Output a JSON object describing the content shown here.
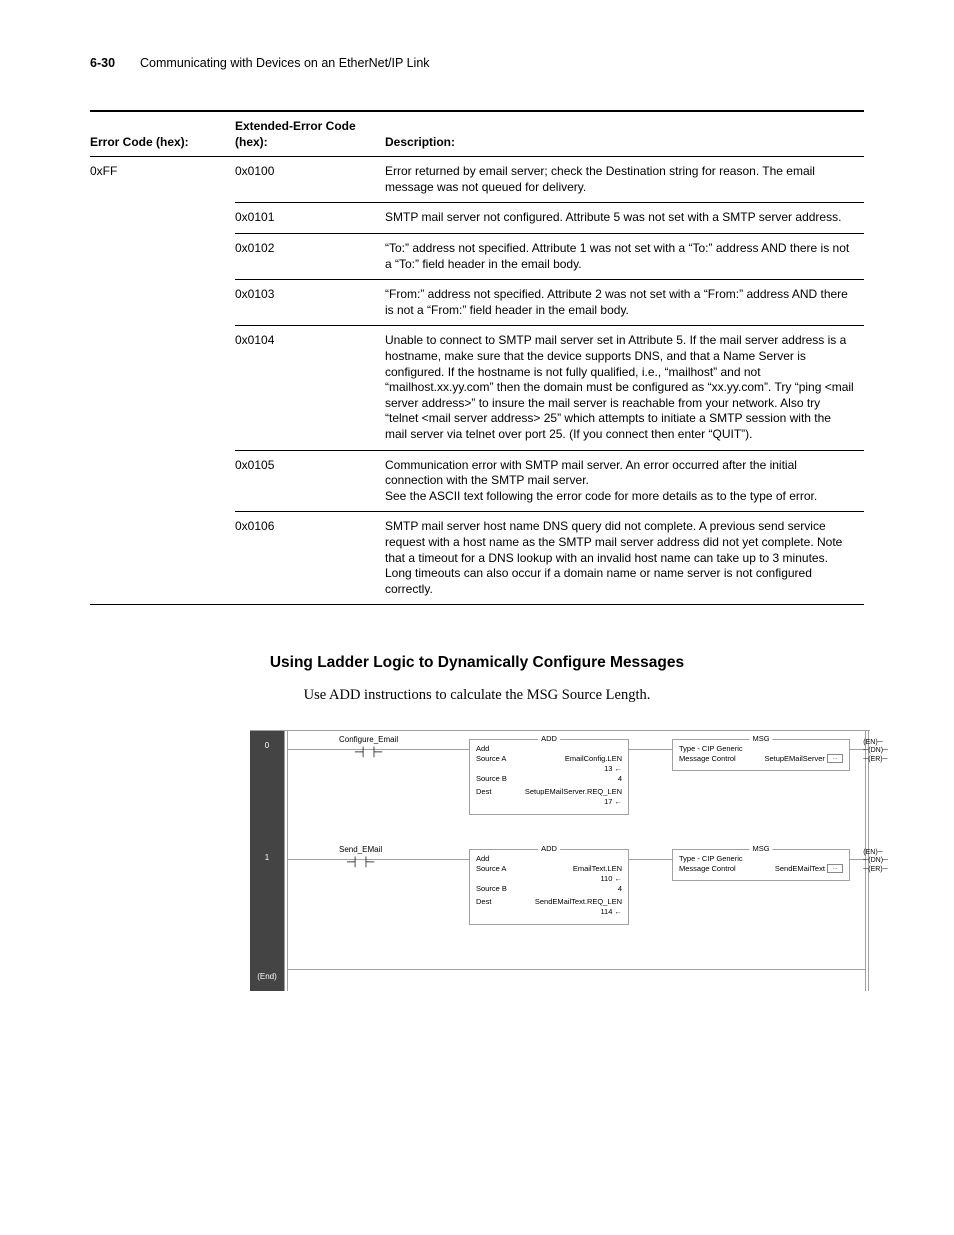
{
  "header": {
    "page_num": "6-30",
    "title": "Communicating with Devices on an EtherNet/IP Link"
  },
  "table": {
    "cols": [
      "Error Code (hex):",
      "Extended-Error Code (hex):",
      "Description:"
    ],
    "error_code": "0xFF",
    "rows": [
      {
        "ext": "0x0100",
        "desc": "Error returned by email server; check the Destination string for reason. The email message was not queued for delivery."
      },
      {
        "ext": "0x0101",
        "desc": "SMTP mail server not configured. Attribute 5 was not set with a SMTP server address."
      },
      {
        "ext": "0x0102",
        "desc": "“To:” address not specified. Attribute 1 was not set with a “To:” address AND there is not a “To:” field header in the email body."
      },
      {
        "ext": "0x0103",
        "desc": "“From:” address not specified. Attribute 2 was not set with a “From:” address AND there is not a “From:” field header in the email body."
      },
      {
        "ext": "0x0104",
        "desc": "Unable to connect to SMTP mail server set in Attribute 5. If the mail server address is a hostname, make sure that the device supports DNS, and that a Name Server is configured. If the hostname is not fully qualified, i.e., “mailhost” and not “mailhost.xx.yy.com” then the domain must be configured as “xx.yy.com”. Try “ping <mail server address>” to insure the mail server is reachable from your network. Also try “telnet <mail server address> 25” which attempts to initiate a SMTP session with the mail server via telnet over port 25. (If you connect then enter “QUIT”)."
      },
      {
        "ext": "0x0105",
        "desc": "Communication error with SMTP mail server. An error occurred after the initial connection with the SMTP mail server.\nSee the ASCII text following the error code for more details as to the type of error."
      },
      {
        "ext": "0x0106",
        "desc": "SMTP mail server host name DNS query did not complete. A previous send service request with a host name as the SMTP mail server address did not yet complete. Note that a timeout for a DNS lookup with an invalid host name can take up to 3 minutes. Long timeouts can also occur if a domain name or name server is not configured correctly."
      }
    ]
  },
  "section": {
    "heading": "Using Ladder Logic to Dynamically Configure Messages",
    "body": "Use ADD instructions to calculate the MSG Source Length."
  },
  "ladder": {
    "gut": [
      "0",
      "1",
      "(End)"
    ],
    "r0": {
      "xic": "Configure_Email",
      "add_t": "ADD",
      "add": [
        "Add",
        "Source A",
        "EmailConfig.LEN",
        "13",
        "Source B",
        "4",
        "Dest",
        "SetupEMailServer.REQ_LEN",
        "17"
      ],
      "msg_t": "MSG",
      "msg_l1": "Type - CIP Generic",
      "msg_l2": "Message Control",
      "msg_r": "SetupEMailServer",
      "out": [
        "(EN)",
        "(DN)",
        "(ER)"
      ]
    },
    "r1": {
      "xic": "Send_EMail",
      "add_t": "ADD",
      "add": [
        "Add",
        "Source A",
        "EmailText.LEN",
        "110",
        "Source B",
        "4",
        "Dest",
        "SendEMailText.REQ_LEN",
        "114"
      ],
      "msg_t": "MSG",
      "msg_l1": "Type - CIP Generic",
      "msg_l2": "Message Control",
      "msg_r": "SendEMailText",
      "out": [
        "(EN)",
        "(DN)",
        "(ER)"
      ]
    }
  }
}
